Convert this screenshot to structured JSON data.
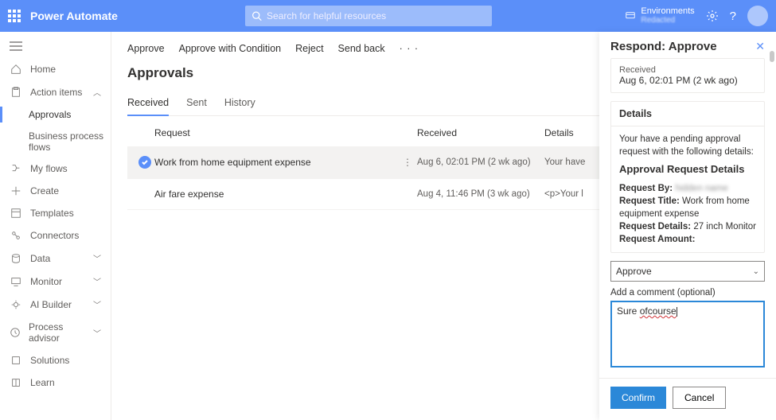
{
  "topbar": {
    "brand": "Power Automate",
    "search_placeholder": "Search for helpful resources",
    "env_label": "Environments",
    "env_value": "Redacted"
  },
  "sidebar": {
    "home": "Home",
    "action_items": "Action items",
    "approvals": "Approvals",
    "bpf": "Business process flows",
    "my_flows": "My flows",
    "create": "Create",
    "templates": "Templates",
    "connectors": "Connectors",
    "data": "Data",
    "monitor": "Monitor",
    "ai_builder": "AI Builder",
    "process_advisor": "Process advisor",
    "solutions": "Solutions",
    "learn": "Learn"
  },
  "cmdbar": {
    "approve": "Approve",
    "approve_cond": "Approve with Condition",
    "reject": "Reject",
    "send_back": "Send back"
  },
  "page": {
    "title": "Approvals",
    "tabs": {
      "received": "Received",
      "sent": "Sent",
      "history": "History"
    },
    "cols": {
      "request": "Request",
      "received": "Received",
      "details": "Details"
    }
  },
  "rows": [
    {
      "title": "Work from home equipment expense",
      "received": "Aug 6, 02:01 PM (2 wk ago)",
      "details": "Your have"
    },
    {
      "title": "Air fare expense",
      "received": "Aug 4, 11:46 PM (3 wk ago)",
      "details": "<p>Your l"
    }
  ],
  "panel": {
    "title": "Respond: Approve",
    "received_label": "Received",
    "received_value": "Aug 6, 02:01 PM (2 wk ago)",
    "details_hdr": "Details",
    "intro": "Your have a pending approval request with the following details:",
    "ard": "Approval Request Details",
    "req_by_lbl": "Request By:",
    "req_by_val": "hidden name",
    "req_title_lbl": "Request Title:",
    "req_title_val": "Work from home equipment expense",
    "req_details_lbl": "Request Details:",
    "req_details_val": "27 inch Monitor",
    "req_amount_lbl": "Request Amount:",
    "req_amount_val": "",
    "action_value": "Approve",
    "comment_label": "Add a comment (optional)",
    "comment_prefix": "Sure ",
    "comment_spell": "ofcourse",
    "confirm": "Confirm",
    "cancel": "Cancel"
  }
}
